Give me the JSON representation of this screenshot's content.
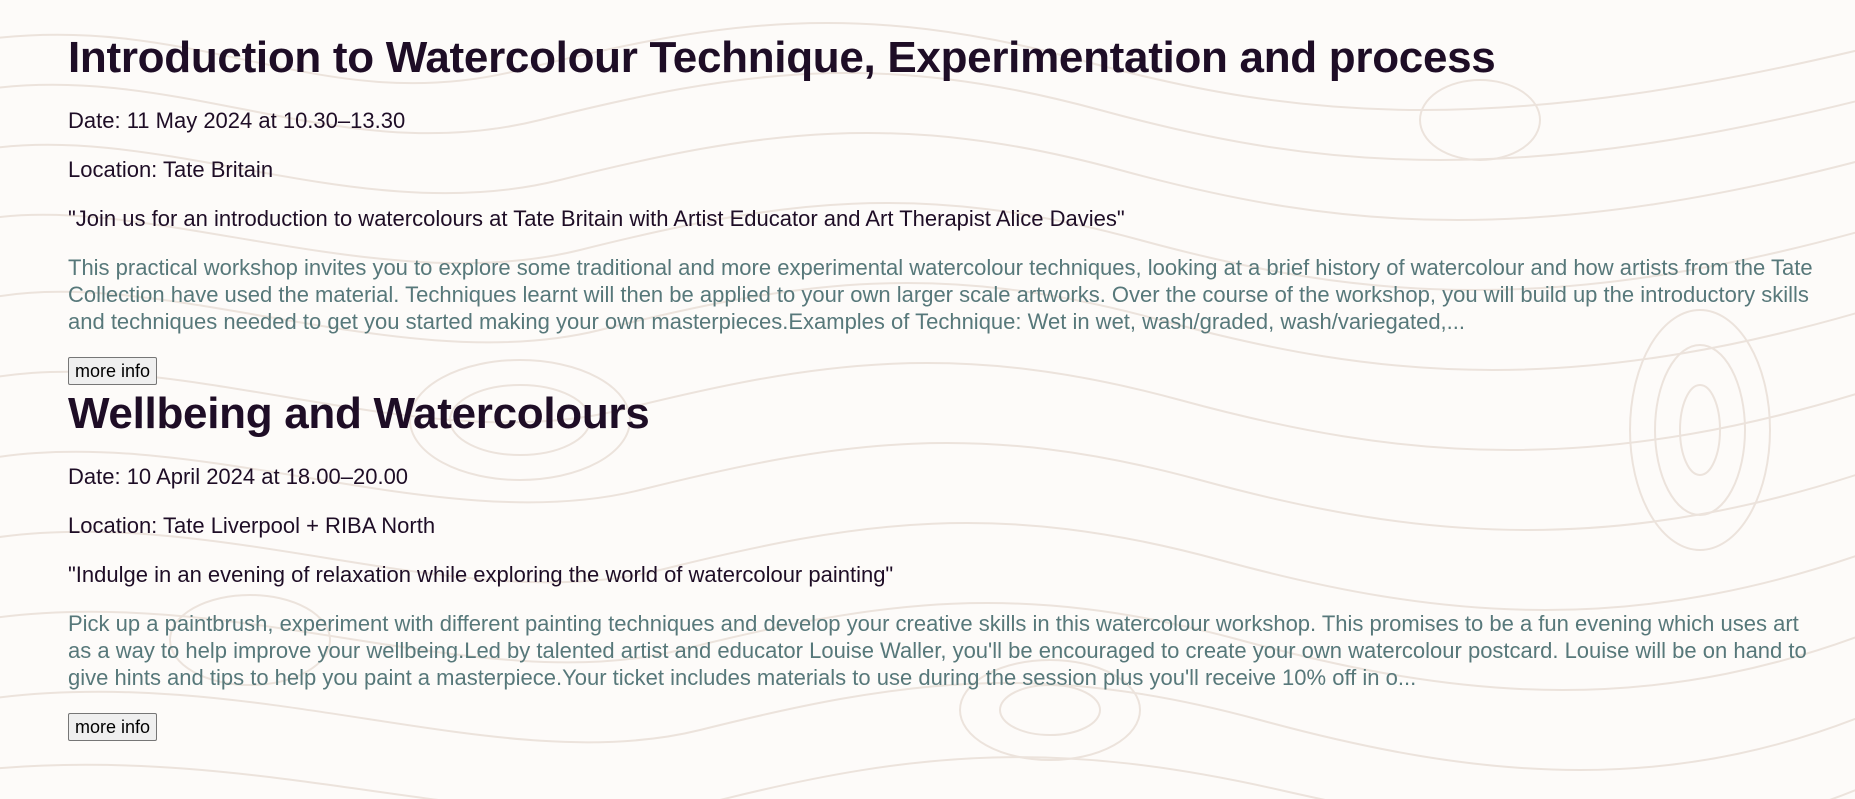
{
  "events": [
    {
      "title": "Introduction to Watercolour Technique, Experimentation and process",
      "date": "Date: 11 May 2024 at 10.30–13.30",
      "location": "Location: Tate Britain",
      "quote": "\"Join us for an introduction to watercolours at Tate Britain with Artist Educator and Art Therapist Alice Davies\"",
      "description": "This practical workshop invites you to explore some traditional and more experimental watercolour techniques, looking at a brief history of watercolour and how artists from the Tate Collection have used the material. Techniques learnt will then be applied to your own larger scale artworks. Over the course of the workshop, you will build up the introductory skills and techniques needed to get you started making your own masterpieces.Examples of Technique: Wet in wet, wash/graded, wash/variegated,...",
      "button_label": "more info"
    },
    {
      "title": "Wellbeing and Watercolours",
      "date": "Date: 10 April 2024 at 18.00–20.00",
      "location": "Location: Tate Liverpool + RIBA North",
      "quote": "\"Indulge in an evening of relaxation while exploring the world of watercolour painting\"",
      "description": "Pick up a paintbrush, experiment with different painting techniques and develop your creative skills in this watercolour workshop. This promises to be a fun evening which uses art as a way to help improve your wellbeing.Led by talented artist and educator Louise Waller, you'll be encouraged to create your own watercolour postcard. Louise will be on hand to give hints and tips to help you paint a masterpiece.Your ticket includes materials to use during the session plus you'll receive 10% off in o...",
      "button_label": "more info"
    }
  ],
  "colors": {
    "title": "#1e0d26",
    "body_text": "#1e0d26",
    "description": "#57787a",
    "background": "#fdfbf9",
    "contour_lines": "#ece3dc"
  }
}
